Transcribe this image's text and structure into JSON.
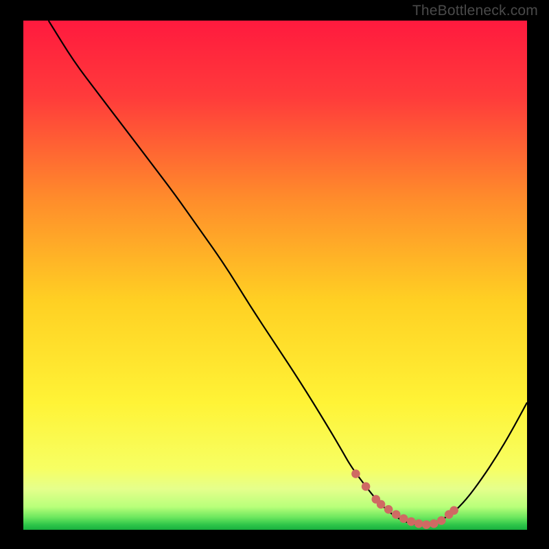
{
  "watermark": "TheBottleneck.com",
  "chart_data": {
    "type": "line",
    "title": "",
    "xlabel": "",
    "ylabel": "",
    "xlim": [
      0,
      100
    ],
    "ylim": [
      0,
      100
    ],
    "grid": false,
    "legend": false,
    "series": [
      {
        "name": "bottleneck-curve",
        "x": [
          5,
          10,
          15,
          20,
          25,
          30,
          35,
          40,
          45,
          50,
          55,
          60,
          63,
          65,
          68,
          70,
          72,
          74,
          76,
          78,
          80,
          82,
          85,
          88,
          91,
          94,
          97,
          100
        ],
        "values": [
          100,
          92,
          85.5,
          79,
          72.5,
          66,
          59,
          52,
          44,
          36.5,
          29,
          21,
          16,
          12.5,
          8.5,
          6,
          4,
          2.5,
          1.5,
          1,
          1,
          1.5,
          3,
          6,
          10,
          14.5,
          19.5,
          25
        ]
      }
    ],
    "markers": {
      "name": "highlight-dots",
      "x": [
        66,
        68,
        70,
        71,
        72.5,
        74,
        75.5,
        77,
        78.5,
        80,
        81.5,
        83,
        84.5,
        85.5
      ],
      "values": [
        11,
        8.5,
        6,
        5,
        4,
        3,
        2.2,
        1.6,
        1.2,
        1,
        1.2,
        1.8,
        3,
        3.8
      ]
    },
    "gradient_stops": [
      {
        "offset": 0.0,
        "color": "#ff1a3e"
      },
      {
        "offset": 0.15,
        "color": "#ff3b3b"
      },
      {
        "offset": 0.35,
        "color": "#ff8c2b"
      },
      {
        "offset": 0.55,
        "color": "#ffd023"
      },
      {
        "offset": 0.75,
        "color": "#fff336"
      },
      {
        "offset": 0.88,
        "color": "#f7ff63"
      },
      {
        "offset": 0.92,
        "color": "#e5ff8c"
      },
      {
        "offset": 0.955,
        "color": "#b8ff7a"
      },
      {
        "offset": 0.975,
        "color": "#6fe85f"
      },
      {
        "offset": 0.99,
        "color": "#2fc64a"
      },
      {
        "offset": 1.0,
        "color": "#18b03e"
      }
    ]
  }
}
